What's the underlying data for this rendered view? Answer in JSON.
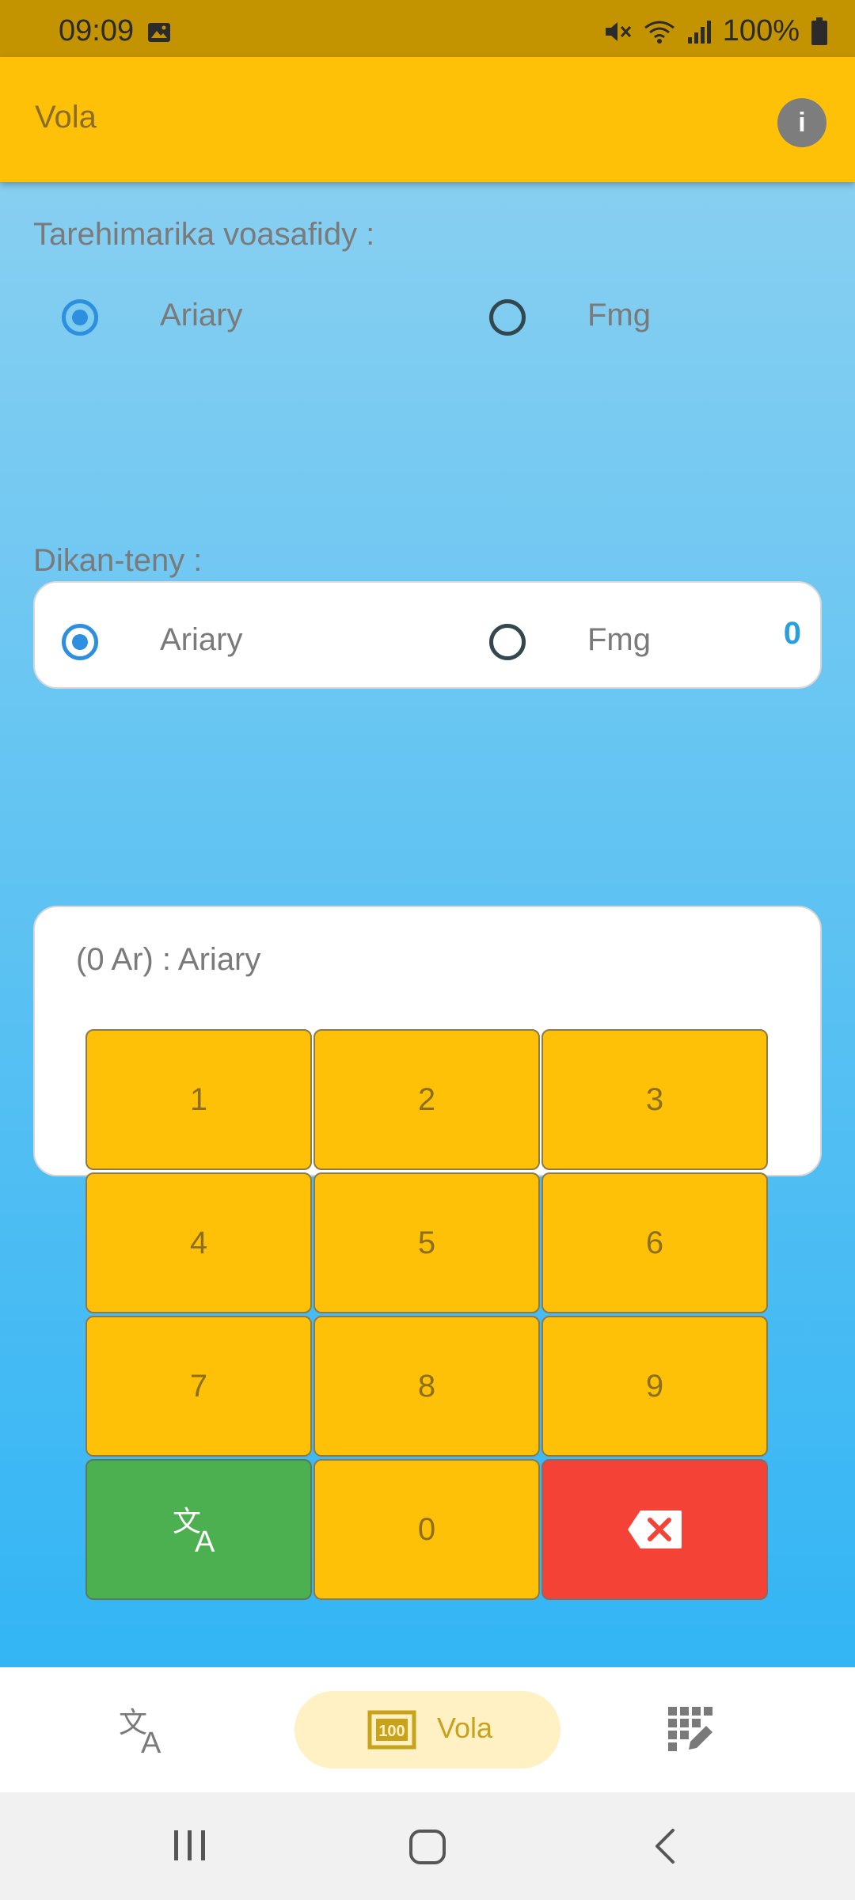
{
  "status_bar": {
    "time": "09:09",
    "battery": "100%"
  },
  "app_bar": {
    "title": "Vola",
    "info_icon": "info-icon"
  },
  "source": {
    "label": "Tarehimarika voasafidy :",
    "options": [
      {
        "label": "Ariary",
        "selected": true
      },
      {
        "label": "Fmg",
        "selected": false
      }
    ],
    "value": "0"
  },
  "target": {
    "label": "Dikan-teny :",
    "options": [
      {
        "label": "Ariary",
        "selected": true
      },
      {
        "label": "Fmg",
        "selected": false
      }
    ],
    "result": "(0  Ar) :  Ariary"
  },
  "keypad": {
    "keys": [
      "1",
      "2",
      "3",
      "4",
      "5",
      "6",
      "7",
      "8",
      "9",
      "0"
    ],
    "translate_icon": "translate-icon",
    "backspace_icon": "backspace-icon"
  },
  "bottom_nav": {
    "items": [
      {
        "icon": "translate-icon",
        "label": ""
      },
      {
        "icon": "money-icon",
        "label": "Vola"
      },
      {
        "icon": "dialpad-edit-icon",
        "label": ""
      }
    ]
  },
  "colors": {
    "accent": "#FFC107",
    "status_bar": "#C49300",
    "radio_selected": "#2C8FE0",
    "value_text": "#2A9FE0",
    "green_key": "#4CAF50",
    "red_key": "#F44336"
  }
}
